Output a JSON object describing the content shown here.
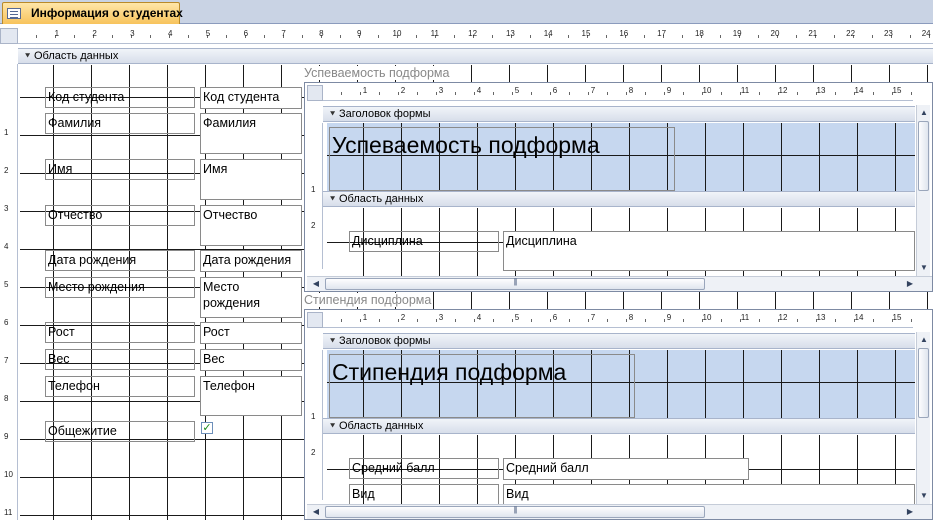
{
  "tab": {
    "title": "Информация о студентах",
    "icon": "form-icon"
  },
  "ruler": {
    "main_ticks": [
      "1",
      "2",
      "3",
      "4",
      "5",
      "6",
      "7",
      "8",
      "9",
      "10",
      "11",
      "12",
      "13",
      "14",
      "15",
      "16",
      "17",
      "18",
      "19",
      "20",
      "21",
      "22",
      "23",
      "24"
    ],
    "main_vticks": [
      "1",
      "2",
      "3",
      "4",
      "5",
      "6",
      "7",
      "8",
      "9",
      "10",
      "11"
    ],
    "sub_ticks": [
      "1",
      "2",
      "3",
      "4",
      "5",
      "6",
      "7",
      "8",
      "9",
      "10",
      "11",
      "12",
      "13",
      "14",
      "15"
    ],
    "sub_vticks": [
      "1",
      "2"
    ]
  },
  "main": {
    "section_detail": "Область данных",
    "fields": [
      {
        "label": "Код студента",
        "value": "Код студента"
      },
      {
        "label": "Фамилия",
        "value": "Фамилия"
      },
      {
        "label": "Имя",
        "value": "Имя"
      },
      {
        "label": "Отчество",
        "value": "Отчество"
      },
      {
        "label": "Дата рождения",
        "value": "Дата рождения"
      },
      {
        "label": "Место рождения",
        "value": "Место рождения"
      },
      {
        "label": "Рост",
        "value": "Рост"
      },
      {
        "label": "Вес",
        "value": "Вес"
      },
      {
        "label": "Телефон",
        "value": "Телефон"
      },
      {
        "label": "Общежитие",
        "value": "✓"
      }
    ]
  },
  "subform1": {
    "caption": "Успеваемость подформа",
    "section_header": "Заголовок формы",
    "title": "Успеваемость подформа",
    "section_detail": "Область данных",
    "fields": [
      {
        "label": "Дисциплина",
        "value": "Дисциплина"
      }
    ]
  },
  "subform2": {
    "caption": "Стипендия подформа",
    "section_header": "Заголовок формы",
    "title": "Стипендия подформа",
    "section_detail": "Область данных",
    "fields": [
      {
        "label": "Средний балл",
        "value": "Средний балл"
      },
      {
        "label": "Вид",
        "value": "Вид"
      }
    ]
  },
  "scroll": {
    "left": "◀",
    "right": "▶",
    "up": "▲",
    "down": "▼"
  }
}
